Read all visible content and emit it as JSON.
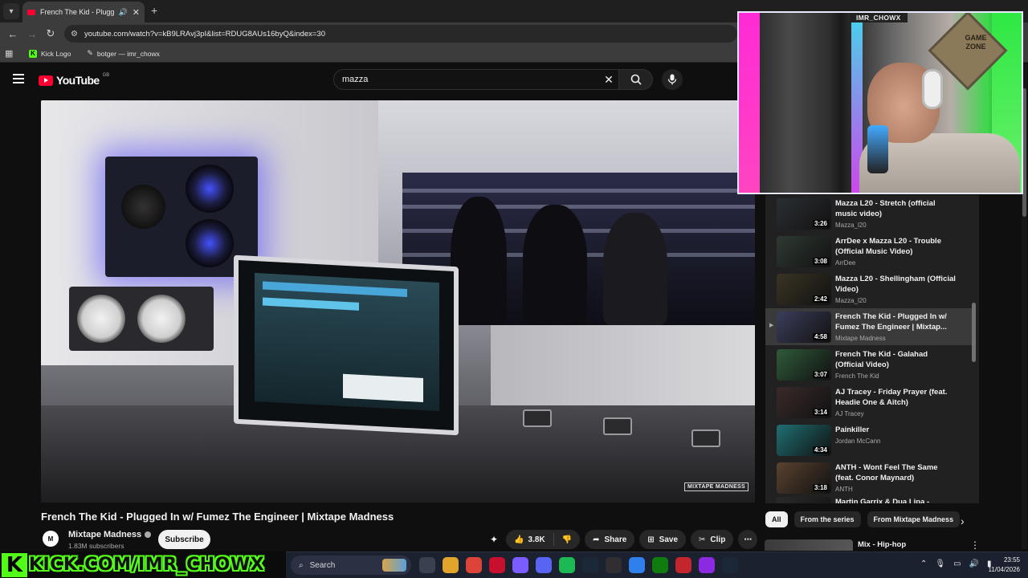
{
  "browser": {
    "tab_title": "French The Kid - Plugged In w/ Fumez The Engineer | Mixtape Madness",
    "url": "youtube.com/watch?v=kB9LRAvj3pI&list=RDUG8AUs16byQ&index=30",
    "bookmarks": [
      {
        "label": "Kick Logo",
        "icon": "kick-icon"
      },
      {
        "label": "botger — imr_chowx",
        "icon": "tool-icon"
      }
    ]
  },
  "youtube": {
    "logo_text": "YouTube",
    "region": "GB",
    "search_query": "mazza"
  },
  "video": {
    "watermark": "MIXTAPE MADNESS",
    "title": "French The Kid - Plugged In w/ Fumez The Engineer | Mixtape Madness",
    "channel_name": "Mixtape Madness",
    "channel_avatar": "M",
    "subscribers": "1.83M subscribers",
    "subscribe_label": "Subscribe",
    "likes": "3.8K",
    "share_label": "Share",
    "save_label": "Save",
    "clip_label": "Clip"
  },
  "playlist": {
    "items": [
      {
        "title": "Mazza L20 - Stretch (official music video)",
        "channel": "Mazza_l20",
        "duration": "3:26",
        "thumb": "#2b2f33"
      },
      {
        "title": "ArrDee x Mazza L20 - Trouble (Official Music Video)",
        "channel": "ArrDee",
        "duration": "3:08",
        "thumb": "#2f3a33"
      },
      {
        "title": "Mazza L20 - Shellingham (Official Video)",
        "channel": "Mazza_l20",
        "duration": "2:42",
        "thumb": "#3a3424"
      },
      {
        "title": "French The Kid - Plugged In w/ Fumez The Engineer | Mixtap...",
        "channel": "Mixtape Madness",
        "duration": "4:58",
        "thumb": "#3b3e5c",
        "active": true
      },
      {
        "title": "French The Kid - Galahad (Official Video)",
        "channel": "French The Kid",
        "duration": "3:07",
        "thumb": "#2f5a3a"
      },
      {
        "title": "AJ Tracey - Friday Prayer (feat. Headie One & Aitch)",
        "channel": "AJ Tracey",
        "duration": "3:14",
        "thumb": "#3a2a2a"
      },
      {
        "title": "Painkiller",
        "channel": "Jordan McCann",
        "duration": "4:34",
        "thumb": "#1f6f72"
      },
      {
        "title": "ANTH - Wont Feel The Same (feat. Conor Maynard)",
        "channel": "ANTH",
        "duration": "3:18",
        "thumb": "#5a4230"
      },
      {
        "title": "Martin Garrix & Dua Lipa -",
        "channel": "",
        "duration": "",
        "thumb": "#2a2a2a"
      }
    ]
  },
  "chips": [
    "All",
    "From the series",
    "From Mixtape Madness"
  ],
  "recommendation": {
    "title": "Mix - Hip-hop"
  },
  "webcam": {
    "name_tag": "IMR_CHOWX",
    "sign_text": "GAME ZONE"
  },
  "kick_banner": {
    "logo": "K",
    "text": "KICK.COM/IMR_CHOWX"
  },
  "taskbar": {
    "search_label": "Search",
    "apps": [
      {
        "icon": "task-view-icon",
        "color": "#3a4050"
      },
      {
        "icon": "file-explorer-icon",
        "color": "#e0a52a"
      },
      {
        "icon": "chrome-icon",
        "color": "#db4437"
      },
      {
        "icon": "adobe-icon",
        "color": "#c8102e"
      },
      {
        "icon": "app-icon",
        "color": "#7a5cff"
      },
      {
        "icon": "discord-icon",
        "color": "#5865f2"
      },
      {
        "icon": "spotify-icon",
        "color": "#1db954"
      },
      {
        "icon": "steam-icon",
        "color": "#1b2838"
      },
      {
        "icon": "obs-icon",
        "color": "#302e31"
      },
      {
        "icon": "app-icon-2",
        "color": "#2f80ed"
      },
      {
        "icon": "xbox-icon",
        "color": "#107c10"
      },
      {
        "icon": "app-icon-3",
        "color": "#c4262e"
      },
      {
        "icon": "app-icon-4",
        "color": "#8a2be2"
      },
      {
        "icon": "steam-icon-2",
        "color": "#1b2838"
      }
    ],
    "time": "23:55",
    "date": "11/04/2026"
  }
}
